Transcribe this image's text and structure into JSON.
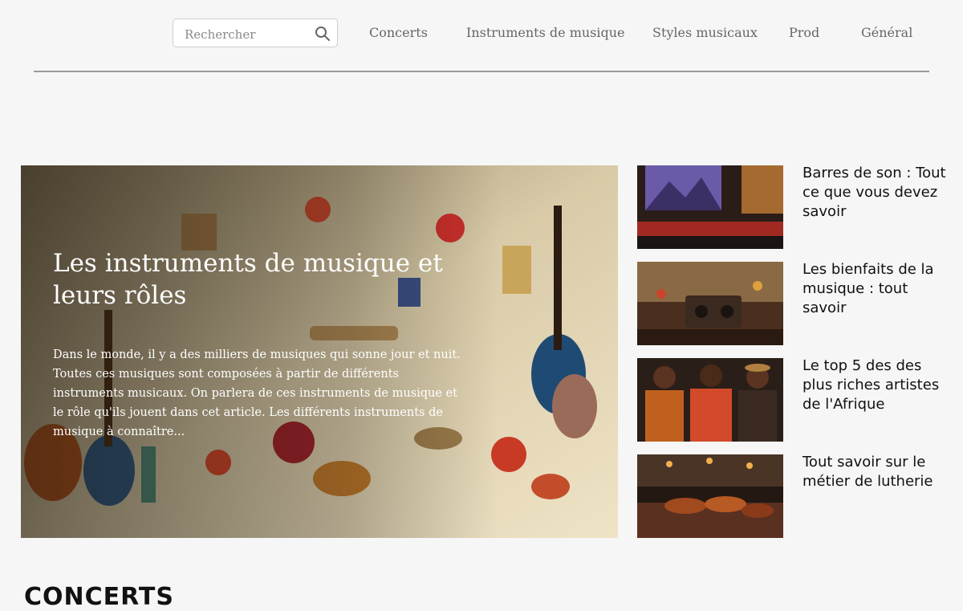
{
  "search": {
    "placeholder": "Rechercher"
  },
  "nav": [
    {
      "label": "Concerts"
    },
    {
      "label": "Instruments de musique"
    },
    {
      "label": "Styles musicaux"
    },
    {
      "label": "Prod"
    },
    {
      "label": "Général"
    }
  ],
  "hero": {
    "title": "Les instruments de musique et leurs rôles",
    "excerpt": "Dans le monde, il y a des milliers de musiques qui sonne jour et nuit. Toutes ces musiques sont composées à partir de différents instruments musicaux. On parlera de ces instruments de musique et le rôle qu'ils jouent dans cet article. Les différents instruments de musique à connaître..."
  },
  "side_articles": [
    {
      "title": "Barres de son : Tout ce que vous devez savoir"
    },
    {
      "title": "Les bienfaits de la musique : tout savoir"
    },
    {
      "title": "Le top 5 des des plus riches artistes de l'Afrique"
    },
    {
      "title": "Tout savoir sur le métier de lutherie"
    }
  ],
  "section": {
    "title": "CONCERTS"
  },
  "colors": {
    "background": "#f6f6f6",
    "nav_text": "#666666",
    "rule": "#9a9a9a"
  }
}
